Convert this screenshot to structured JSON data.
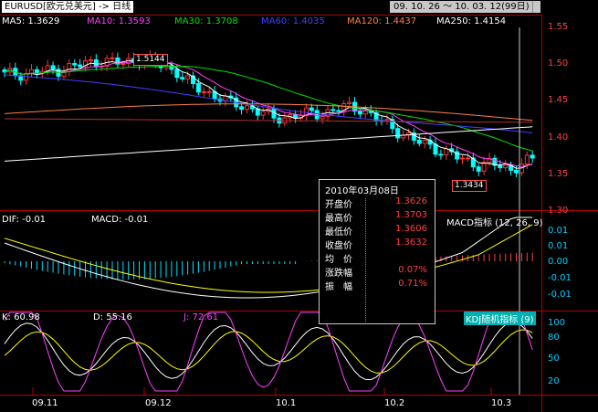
{
  "title": "EURUSD[欧元兑美元] -> 日线",
  "date_range": "09. 10. 26 ～ 10. 03. 12(99日)",
  "ma": [
    {
      "label": "MA5: 1.3629",
      "color": "#ffffff"
    },
    {
      "label": "MA10: 1.3593",
      "color": "#ff40ff"
    },
    {
      "label": "MA30: 1.3708",
      "color": "#00e000"
    },
    {
      "label": "MA60: 1.4035",
      "color": "#4040ff"
    },
    {
      "label": "MA120: 1.4437",
      "color": "#ff8040"
    },
    {
      "label": "MA250: 1.4154",
      "color": "#ffffff"
    }
  ],
  "price_axis": [
    "1.55",
    "1.50",
    "1.45",
    "1.40",
    "1.35",
    "1.30"
  ],
  "high_label": "1.5144",
  "low_label": "1.3434",
  "macd": {
    "dif": "DIF: -0.01",
    "macd": "MACD: -0.01",
    "title": "MACD指标 (12, 26, 9)",
    "axis": [
      "0.01",
      "0.01",
      "0.00",
      "-0.01",
      "-0.01"
    ]
  },
  "kdj": {
    "k": "K: 60.98",
    "d": "D: 55.16",
    "j": "J: 72.61",
    "title": "KDJ随机指标 (9)",
    "axis": [
      "100",
      "80",
      "50",
      "20"
    ]
  },
  "x_labels": [
    "09.11",
    "09.12",
    "10.1",
    "10.2",
    "10.3"
  ],
  "info": {
    "date": "2010年03月08日",
    "rows": [
      {
        "label": "开盘价",
        "value": "1.3626"
      },
      {
        "label": "最高价",
        "value": "1.3703"
      },
      {
        "label": "最低价",
        "value": "1.3606"
      },
      {
        "label": "收盘价",
        "value": "1.3632"
      },
      {
        "label": "均　价",
        "value": ""
      },
      {
        "label": "涨跌幅",
        "value": "0.07%"
      },
      {
        "label": "振　幅",
        "value": "0.71%"
      }
    ]
  },
  "colors": {
    "up": "#ff3030",
    "down": "#00ffff",
    "grid": "#b00000"
  }
}
